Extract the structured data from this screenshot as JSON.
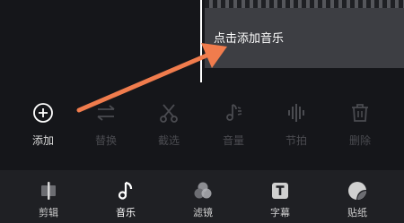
{
  "timeline": {
    "music_track_label": "点击添加音乐"
  },
  "toolbar": {
    "tools": [
      {
        "label": "添加",
        "icon": "add-circle-icon",
        "enabled": true
      },
      {
        "label": "替换",
        "icon": "swap-icon",
        "enabled": false
      },
      {
        "label": "截选",
        "icon": "scissors-icon",
        "enabled": false
      },
      {
        "label": "音量",
        "icon": "volume-icon",
        "enabled": false
      },
      {
        "label": "节拍",
        "icon": "beat-icon",
        "enabled": false
      },
      {
        "label": "删除",
        "icon": "trash-icon",
        "enabled": false
      }
    ]
  },
  "bottom_nav": {
    "items": [
      {
        "label": "剪辑",
        "icon": "clip-edit-icon",
        "active": false
      },
      {
        "label": "音乐",
        "icon": "music-note-icon",
        "active": true
      },
      {
        "label": "滤镜",
        "icon": "filter-icon",
        "active": false
      },
      {
        "label": "字幕",
        "icon": "subtitle-icon",
        "active": false
      },
      {
        "label": "贴纸",
        "icon": "sticker-icon",
        "active": false
      }
    ]
  },
  "colors": {
    "background": "#15161a",
    "nav_background": "#1f2024",
    "track": "#3d3e43",
    "arrow": "#f07c4d",
    "disabled": "#4a4b50"
  }
}
